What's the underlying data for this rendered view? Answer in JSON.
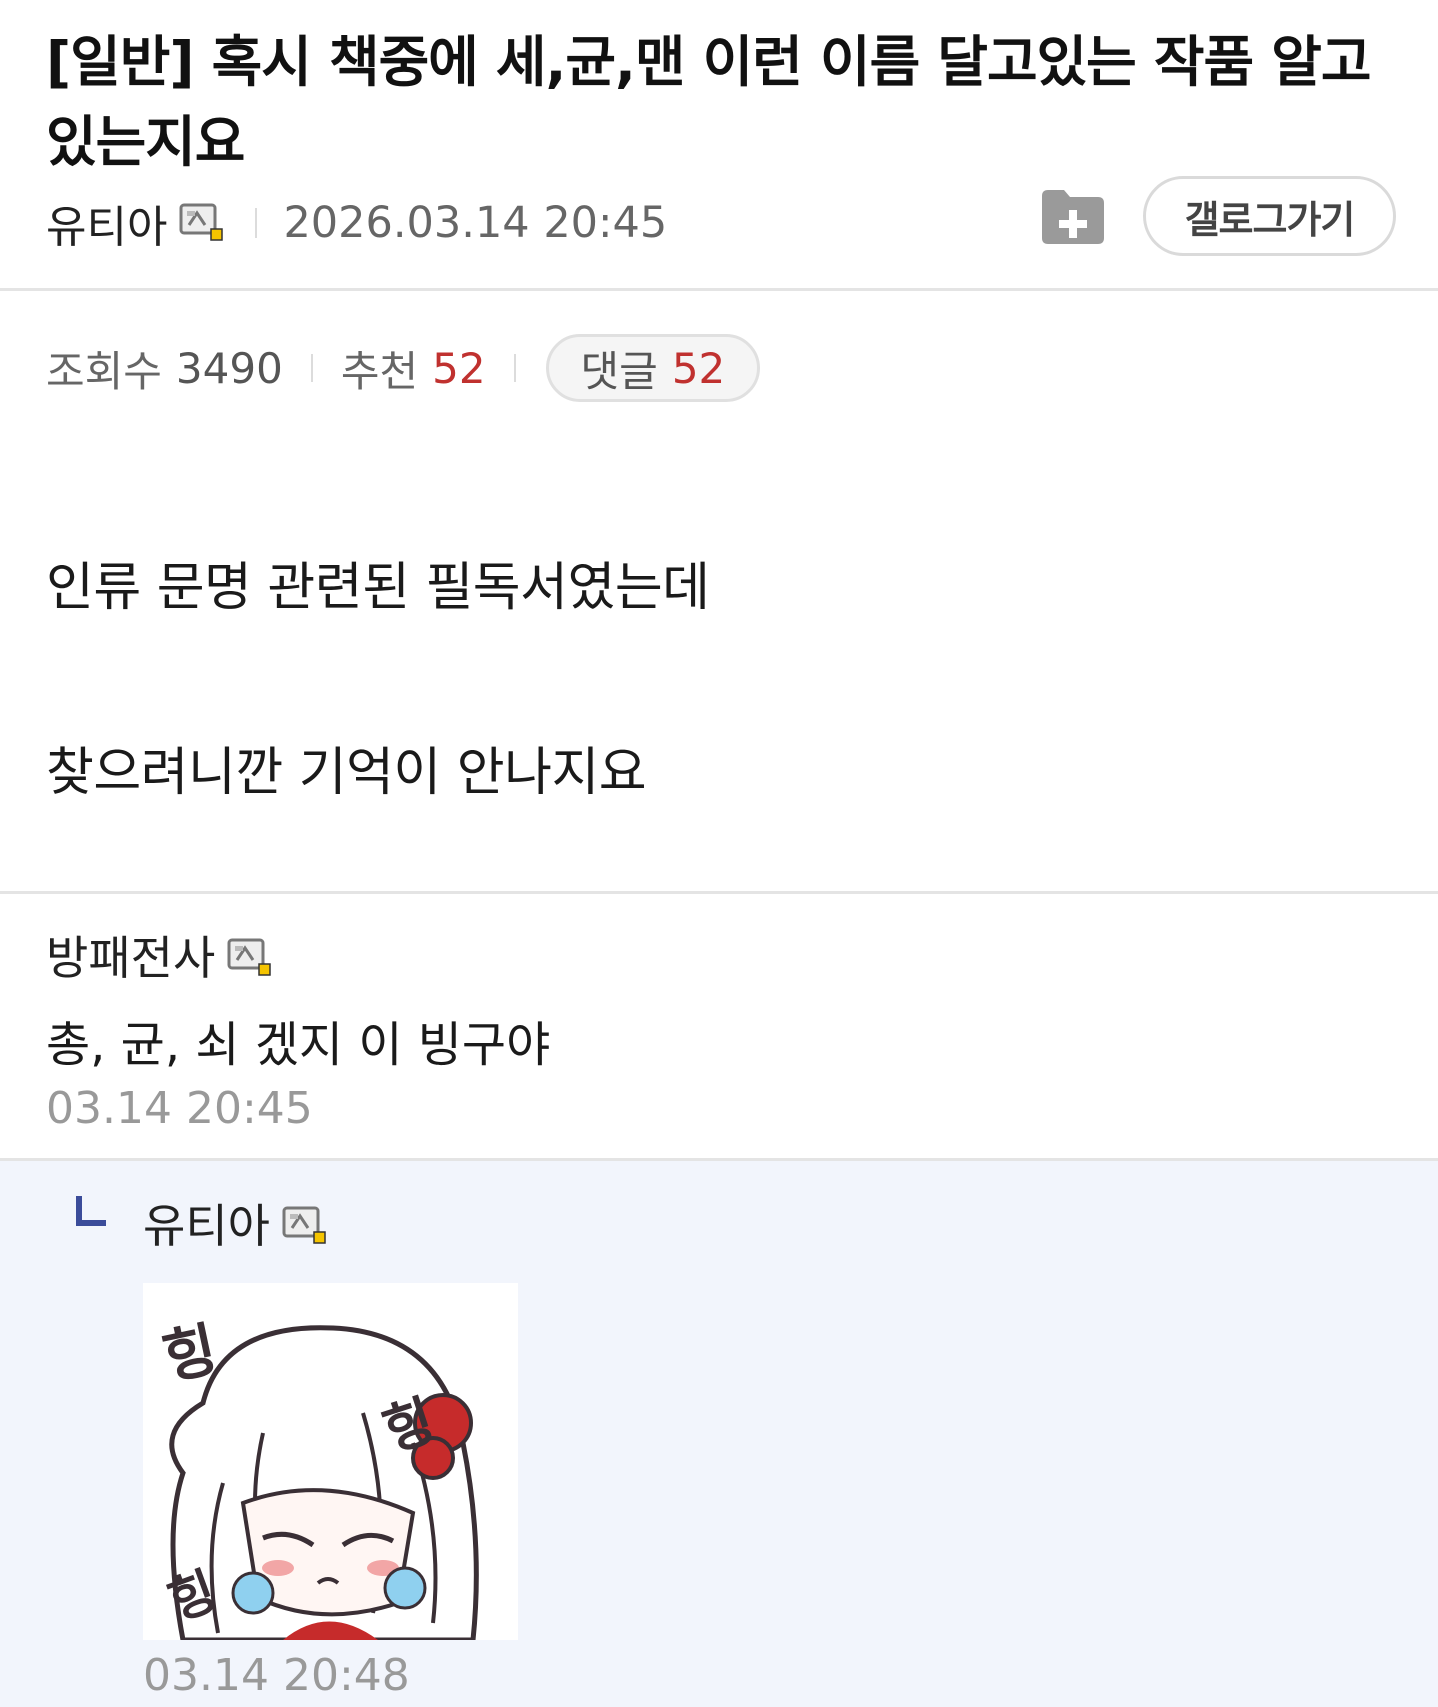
{
  "post": {
    "title": "[일반] 혹시 책중에 세,균,맨 이런 이름 달고있는 작품 알고 있는지요",
    "author": "유티아",
    "author_badge_icon": "gallog-fixed-nick-icon",
    "date": "2026.03.14 20:45",
    "folder_icon": "folder-add-icon",
    "gallog_button_label": "갤로그가기",
    "stats": {
      "views_label": "조회수",
      "views": "3490",
      "recommend_label": "추천",
      "recommend": "52",
      "comments_label": "댓글",
      "comments": "52"
    },
    "body": [
      "인류 문명 관련된 필독서였는데",
      "찾으려니깐 기억이 안나지요"
    ]
  },
  "comments": [
    {
      "author": "방패전사",
      "text": "총, 균, 쇠 겠지 이 빙구야",
      "time": "03.14 20:45"
    }
  ],
  "reply": {
    "author": "유티아",
    "sticker_text": [
      "힝",
      "힝",
      "힝"
    ],
    "time": "03.14 20:48"
  },
  "colors": {
    "accent_red": "#c0312f",
    "reply_background": "#f2f5fc",
    "reply_arrow": "#3b4c9a"
  }
}
